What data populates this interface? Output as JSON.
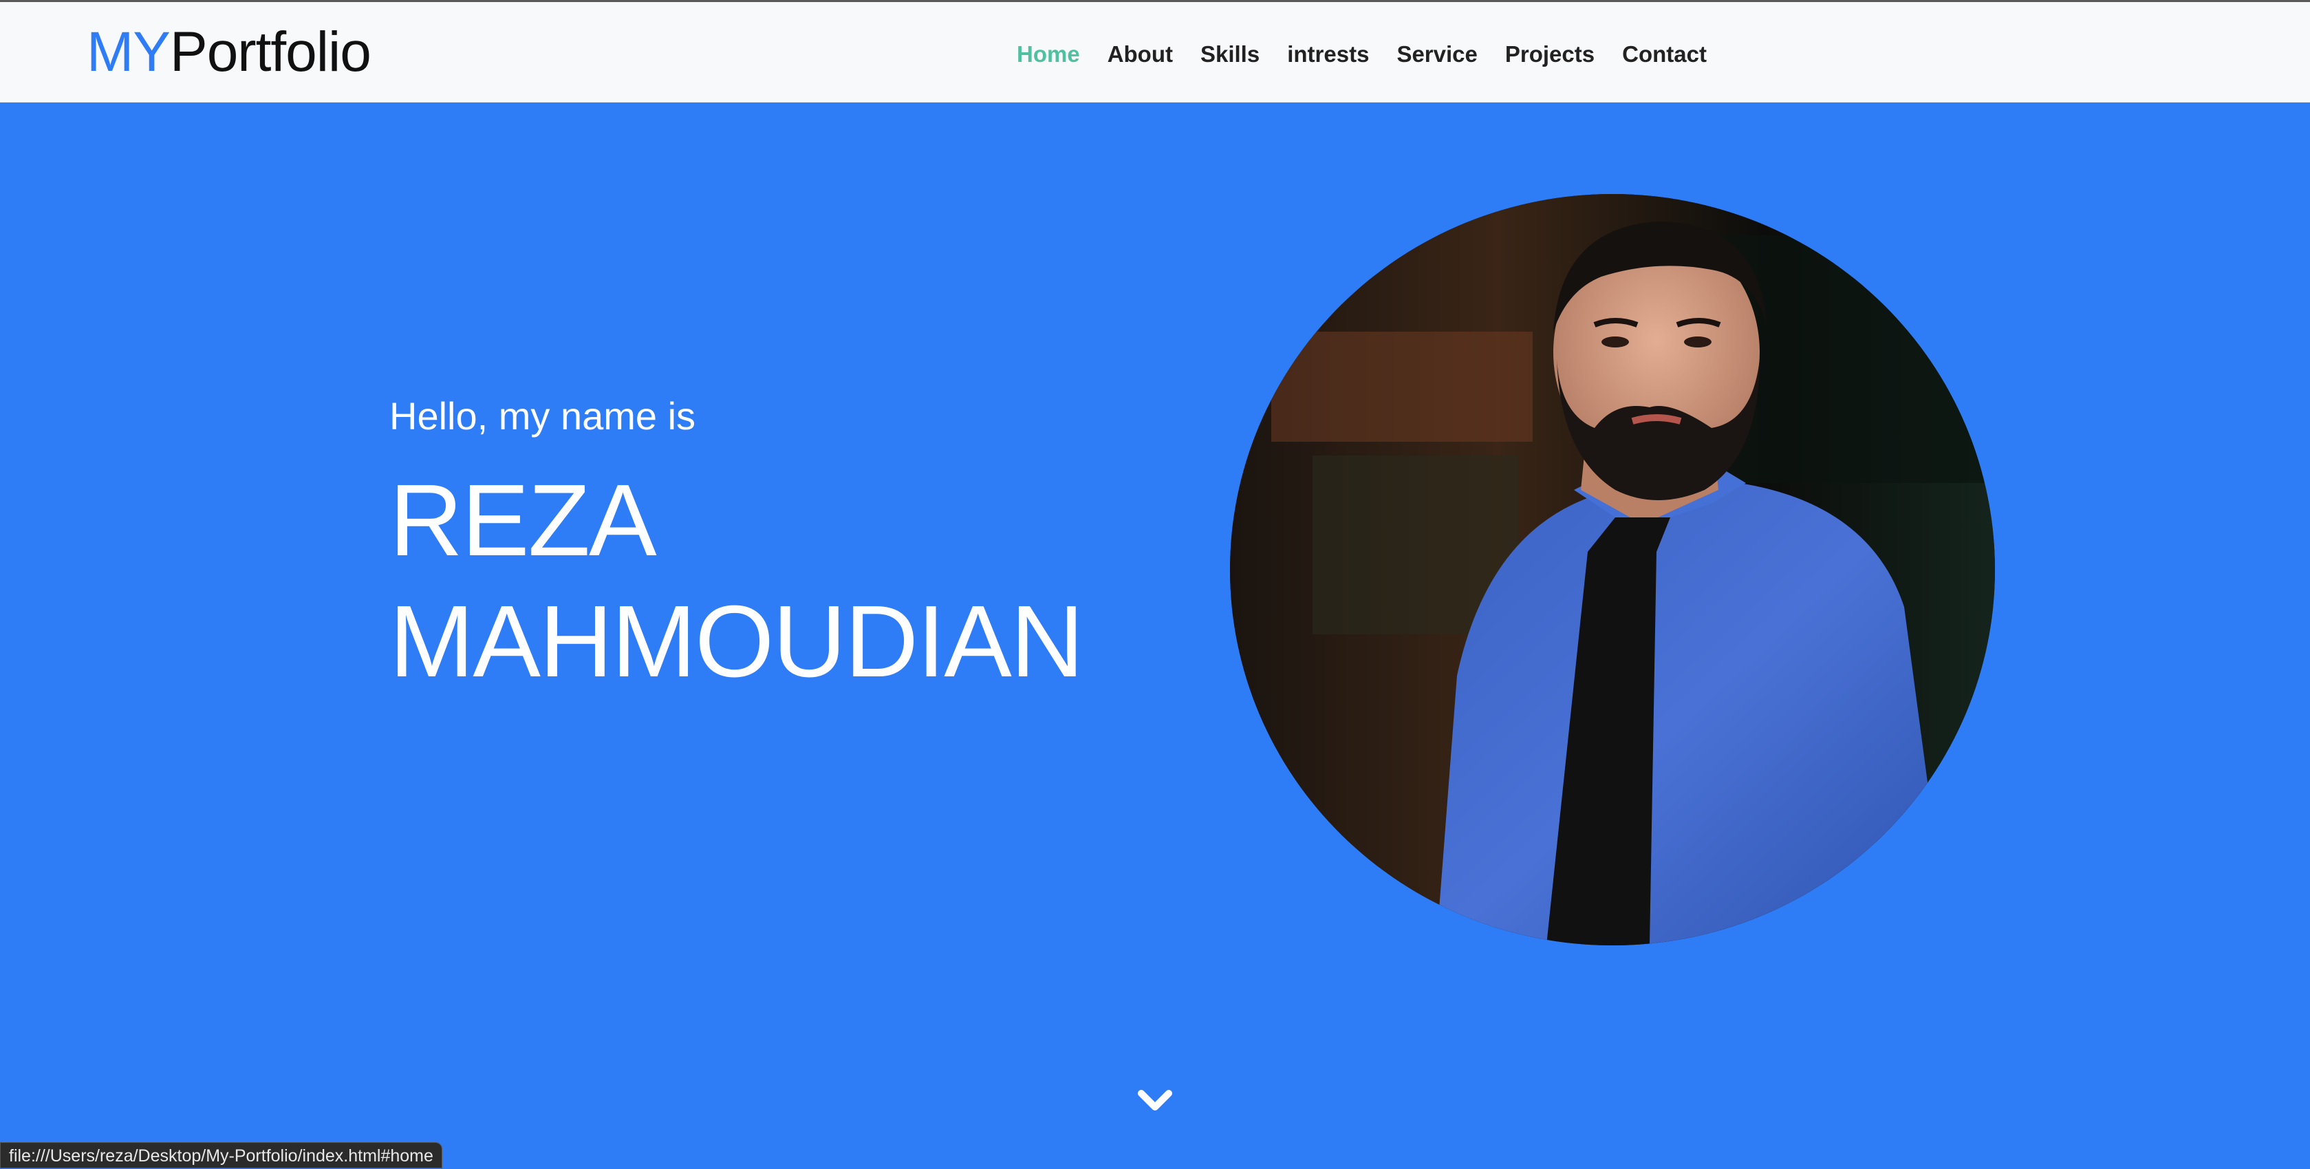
{
  "brand": {
    "prefix": "MY",
    "rest": "Portfolio"
  },
  "nav": {
    "items": [
      {
        "label": "Home",
        "active": true
      },
      {
        "label": "About"
      },
      {
        "label": "Skills"
      },
      {
        "label": "intrests"
      },
      {
        "label": "Service"
      },
      {
        "label": "Projects"
      },
      {
        "label": "Contact"
      }
    ]
  },
  "hero": {
    "greeting": "Hello, my name is",
    "name_line1": "REZA",
    "name_line2": "MAHMOUDIAN",
    "photo_icon": "portrait-photo",
    "scroll_icon": "chevron-down-icon"
  },
  "status_bar": {
    "url": "file:///Users/reza/Desktop/My-Portfolio/index.html#home"
  },
  "colors": {
    "hero_background": "#2e7cf6",
    "navbar_background": "#f8f9fa",
    "brand_accent": "#2e7cf6",
    "nav_active": "#4fc1a0"
  }
}
